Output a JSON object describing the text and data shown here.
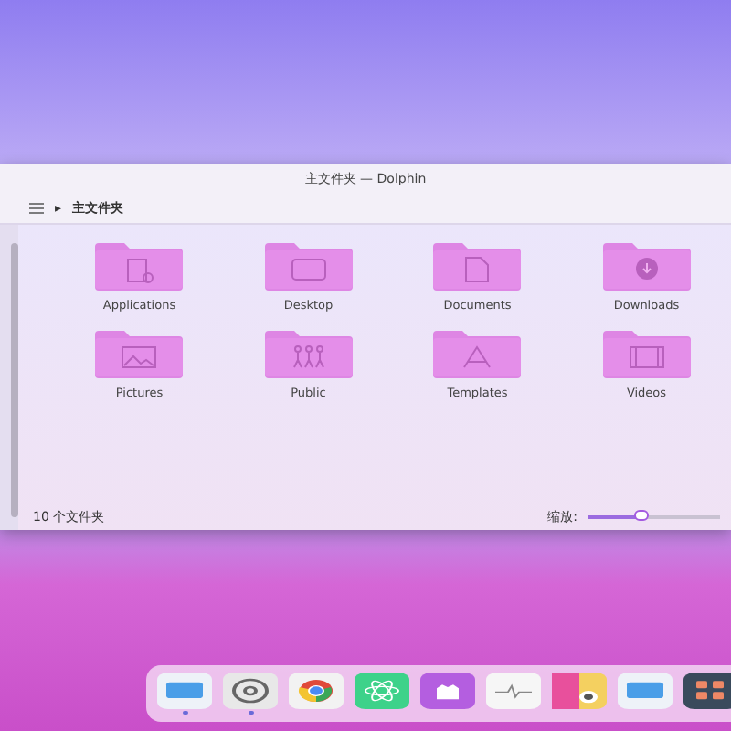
{
  "window": {
    "title": "主文件夹 — Dolphin"
  },
  "toolbar": {
    "breadcrumb_arrow": "▸",
    "breadcrumb": "主文件夹"
  },
  "folders": [
    {
      "name": "Applications",
      "kind": "apps"
    },
    {
      "name": "Desktop",
      "kind": "desktop"
    },
    {
      "name": "Documents",
      "kind": "document"
    },
    {
      "name": "Downloads",
      "kind": "download"
    },
    {
      "name": "Pictures",
      "kind": "picture"
    },
    {
      "name": "Public",
      "kind": "public"
    },
    {
      "name": "Templates",
      "kind": "template"
    },
    {
      "name": "Videos",
      "kind": "video"
    }
  ],
  "status_bar": {
    "text": "10 个文件夹",
    "zoom_label": "缩放:",
    "zoom": {
      "level": 0.4
    }
  },
  "dock": [
    {
      "kind": "files",
      "running": true
    },
    {
      "kind": "settings",
      "running": true
    },
    {
      "kind": "browser",
      "running": false
    },
    {
      "kind": "atom",
      "running": false
    },
    {
      "kind": "cat",
      "running": false
    },
    {
      "kind": "monitor",
      "running": false
    },
    {
      "kind": "palette",
      "running": false
    },
    {
      "kind": "files",
      "running": false
    },
    {
      "kind": "grid",
      "running": false
    }
  ]
}
